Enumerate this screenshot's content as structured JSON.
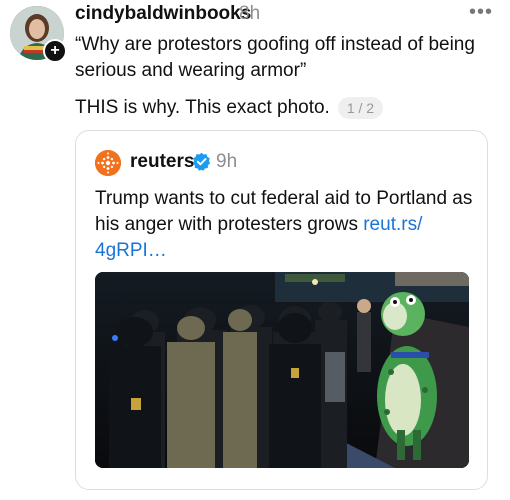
{
  "post": {
    "username": "cindybaldwinbooks",
    "time": "8h",
    "text": "“Why are protestors goofing off instead of being serious and wearing armor”",
    "text2": "THIS is why. This exact photo.",
    "page_indicator": "1 / 2",
    "more_icon": "more-horizontal-icon"
  },
  "quoted": {
    "username": "reuters",
    "time": "9h",
    "text": "Trump wants to cut federal aid to Portland as his anger with protesters grows ",
    "link": "reut.rs/ 4gRPI…",
    "verified_icon": "verified-badge-icon",
    "brand_color": "#f2711c",
    "link_color": "#1a74d8"
  }
}
